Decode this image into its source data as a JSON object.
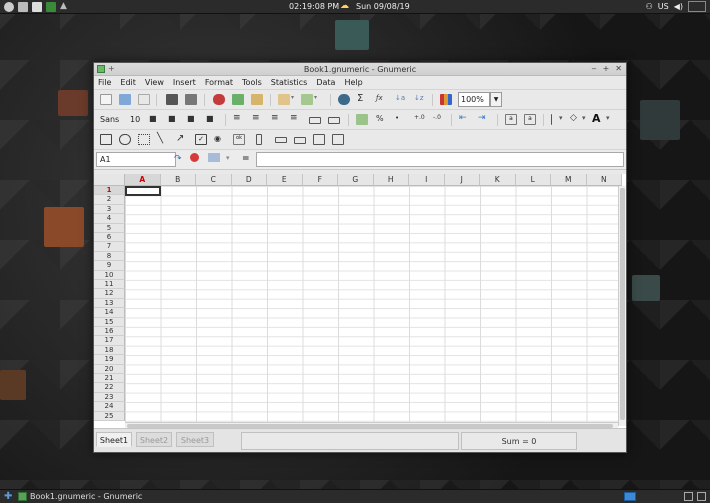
{
  "top_panel": {
    "clock": "02:19:08 PM",
    "date": "Sun 09/08/19",
    "keyboard_layout": "US"
  },
  "window": {
    "title": "Book1.gnumeric - Gnumeric",
    "menu": [
      "File",
      "Edit",
      "View",
      "Insert",
      "Format",
      "Tools",
      "Statistics",
      "Data",
      "Help"
    ],
    "zoom": "100%",
    "font_name": "Sans",
    "font_size": "10",
    "font_style_glyph": "A"
  },
  "editbar": {
    "cell_ref": "A1",
    "equals": "=",
    "formula": ""
  },
  "grid": {
    "columns": [
      "A",
      "B",
      "C",
      "D",
      "E",
      "F",
      "G",
      "H",
      "I",
      "J",
      "K",
      "L",
      "M",
      "N"
    ],
    "rows": [
      "1",
      "2",
      "3",
      "4",
      "5",
      "6",
      "7",
      "8",
      "9",
      "10",
      "11",
      "12",
      "13",
      "14",
      "15",
      "16",
      "17",
      "18",
      "19",
      "20",
      "21",
      "22",
      "23",
      "24",
      "25"
    ]
  },
  "sheets": [
    "Sheet1",
    "Sheet2",
    "Sheet3"
  ],
  "status": {
    "sum": "Sum = 0"
  },
  "taskbar": {
    "task_label": "Book1.gnumeric - Gnumeric"
  },
  "colors": {
    "accent": "#3a8ad8",
    "selected_header_text": "#cc0000"
  }
}
